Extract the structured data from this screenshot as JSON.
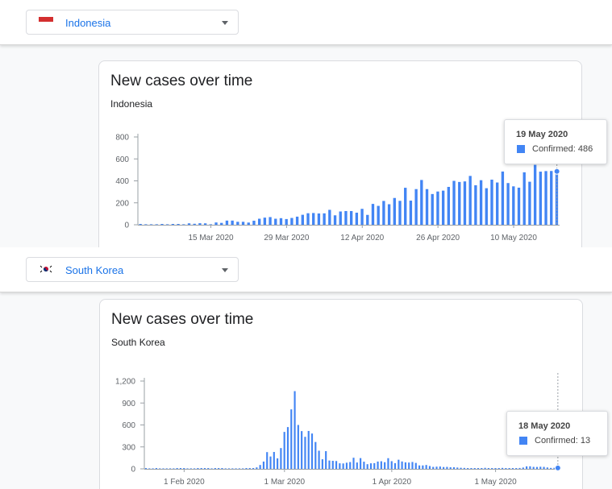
{
  "panels": [
    {
      "country": "Indonesia",
      "card_title": "New cases over time",
      "card_subtitle": "Indonesia",
      "tooltip": {
        "date": "19 May 2020",
        "label": "Confirmed: 486"
      }
    },
    {
      "country": "South Korea",
      "card_title": "New cases over time",
      "card_subtitle": "South Korea",
      "tooltip": {
        "date": "18 May 2020",
        "label": "Confirmed: 13"
      }
    }
  ],
  "colors": {
    "bar": "#4285f4",
    "select_text": "#1a73e8",
    "axis": "#5f6368"
  },
  "chart_data": [
    {
      "type": "bar",
      "title": "New cases over time",
      "subtitle": "Indonesia",
      "ylim": [
        0,
        800
      ],
      "yticks": [
        "800",
        "600",
        "400",
        "200",
        "0"
      ],
      "ytick_values": [
        800,
        600,
        400,
        200,
        0
      ],
      "xticks": [
        "15 Mar 2020",
        "29 Mar 2020",
        "12 Apr 2020",
        "26 Apr 2020",
        "10 May 2020"
      ],
      "xtick_index": [
        13,
        27,
        41,
        55,
        69
      ],
      "grid": false,
      "series": [
        {
          "values": [
            2,
            0,
            0,
            0,
            4,
            0,
            6,
            2,
            0,
            13,
            9,
            14,
            13,
            0,
            21,
            17,
            38,
            38,
            27,
            27,
            20,
            37,
            55,
            65,
            70,
            55,
            60,
            52,
            62,
            74,
            91,
            105,
            107,
            103,
            104,
            136,
            86,
            121,
            125,
            125,
            110,
            145,
            90,
            190,
            172,
            217,
            187,
            244,
            218,
            337,
            220,
            325,
            408,
            325,
            280,
            303,
            311,
            345,
            400,
            390,
            395,
            445,
            360,
            406,
            333,
            411,
            385,
            485,
            380,
            350,
            338,
            478,
            392,
            546,
            484,
            489,
            490,
            486
          ]
        }
      ]
    },
    {
      "type": "bar",
      "title": "New cases over time",
      "subtitle": "South Korea",
      "ylim": [
        0,
        1200
      ],
      "yticks": [
        "1,200",
        "900",
        "600",
        "300",
        "0"
      ],
      "ytick_values": [
        1200,
        900,
        600,
        300,
        0
      ],
      "xticks": [
        "1 Feb 2020",
        "1 Mar 2020",
        "1 Apr 2020",
        "1 May 2020"
      ],
      "xtick_index": [
        11,
        40,
        71,
        101
      ],
      "grid": false,
      "series": [
        {
          "values": [
            1,
            0,
            0,
            1,
            0,
            0,
            0,
            0,
            0,
            1,
            1,
            1,
            0,
            0,
            0,
            4,
            1,
            1,
            2,
            0,
            1,
            3,
            1,
            0,
            0,
            0,
            0,
            0,
            0,
            1,
            1,
            2,
            20,
            53,
            100,
            229,
            169,
            231,
            143,
            284,
            505,
            571,
            813,
            1062,
            600,
            516,
            438,
            518,
            483,
            367,
            248,
            131,
            242,
            114,
            110,
            107,
            76,
            74,
            84,
            93,
            152,
            87,
            147,
            98,
            64,
            76,
            78,
            100,
            104,
            91,
            146,
            105,
            78,
            125,
            101,
            89,
            86,
            94,
            81,
            47,
            47,
            53,
            39,
            27,
            30,
            32,
            25,
            27,
            22,
            22,
            18,
            15,
            13,
            9,
            11,
            8,
            6,
            10,
            14,
            9,
            4,
            9,
            6,
            13,
            8,
            3,
            2,
            4,
            12,
            18,
            34,
            35,
            27,
            26,
            29,
            27,
            19,
            13,
            15,
            13
          ]
        }
      ]
    }
  ]
}
